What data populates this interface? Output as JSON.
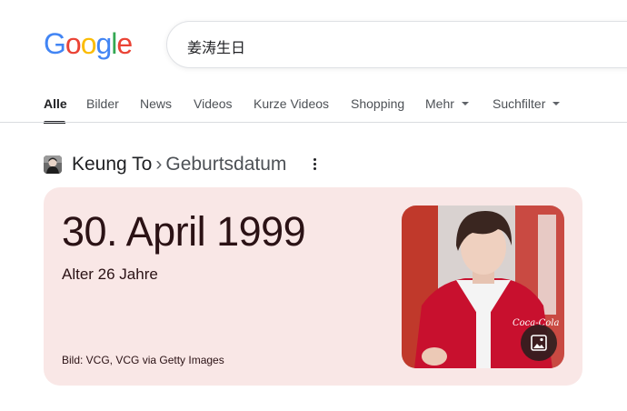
{
  "logo": {
    "letters": [
      "G",
      "o",
      "o",
      "g",
      "l",
      "e"
    ]
  },
  "search": {
    "query": "姜涛生日"
  },
  "tabs": [
    {
      "label": "Alle",
      "active": true
    },
    {
      "label": "Bilder"
    },
    {
      "label": "News"
    },
    {
      "label": "Videos"
    },
    {
      "label": "Kurze Videos"
    },
    {
      "label": "Shopping"
    },
    {
      "label": "Mehr",
      "dropdown": true
    },
    {
      "label": "Suchfilter",
      "dropdown": true
    }
  ],
  "answer": {
    "entity": "Keung To",
    "separator": "›",
    "attribute": "Geburtsdatum",
    "date": "30. April 1999",
    "age": "Alter 26 Jahre",
    "image_credit": "Bild: VCG, VCG via Getty Images",
    "image_brand": "Coca-Cola"
  },
  "icons": {
    "more": "more-vert-icon",
    "image": "image-icon"
  },
  "colors": {
    "card_bg": "#f9e7e6",
    "card_text": "#2b1215",
    "jacket_red": "#c8102e",
    "tab_active": "#202124"
  }
}
